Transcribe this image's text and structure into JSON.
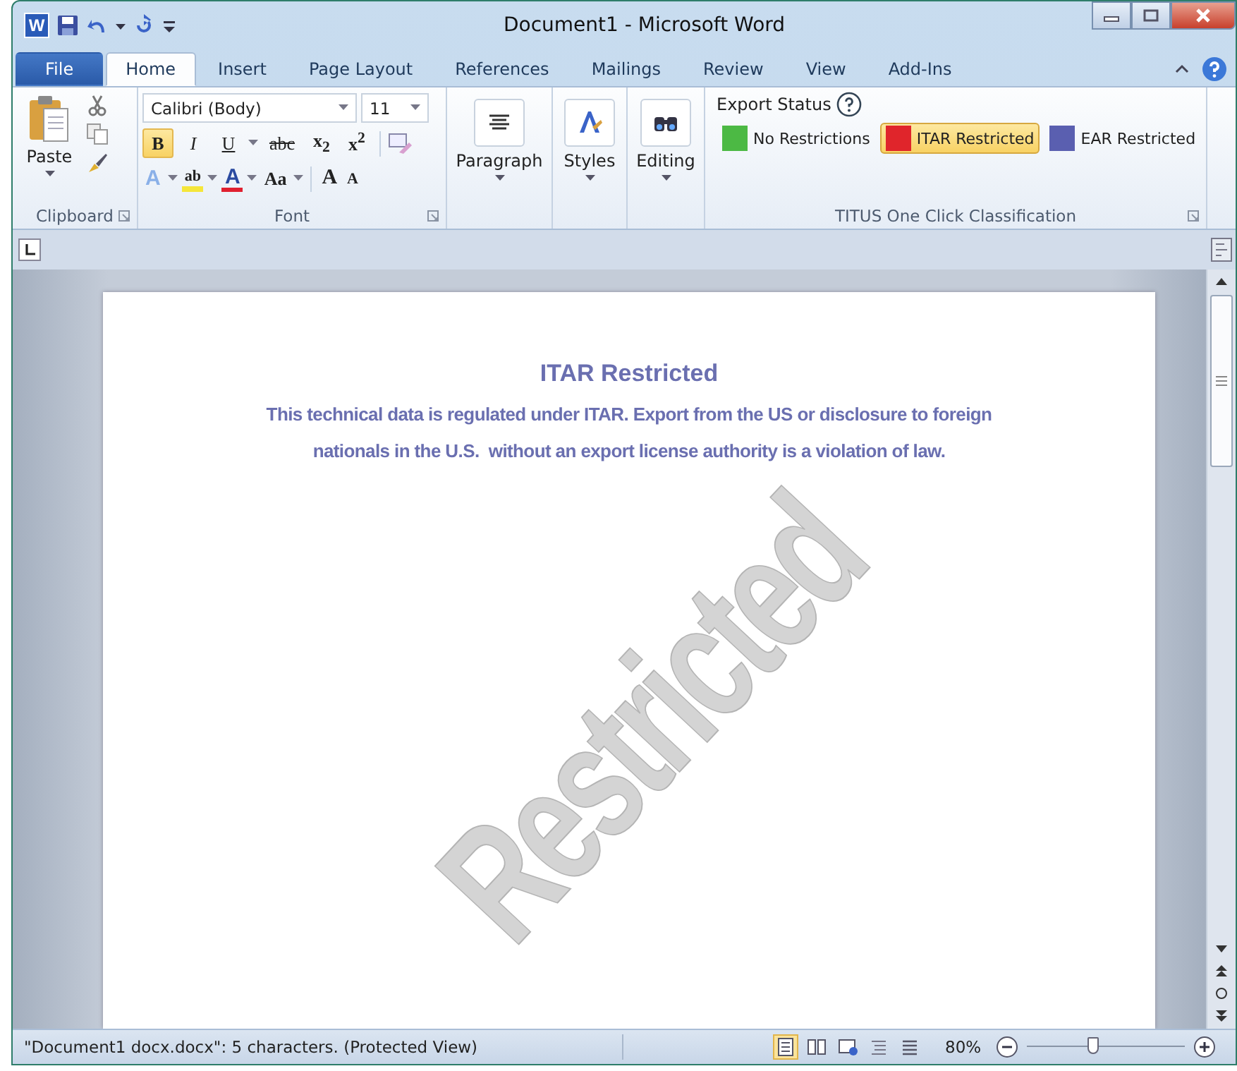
{
  "window": {
    "app_letter": "W",
    "title": "Document1 - Microsoft Word"
  },
  "tabs": [
    {
      "label": "File",
      "kind": "file",
      "selected": false
    },
    {
      "label": "Home",
      "kind": "tab",
      "selected": true
    },
    {
      "label": "Insert",
      "kind": "tab",
      "selected": false
    },
    {
      "label": "Page Layout",
      "kind": "tab",
      "selected": false
    },
    {
      "label": "References",
      "kind": "tab",
      "selected": false
    },
    {
      "label": "Mailings",
      "kind": "tab",
      "selected": false
    },
    {
      "label": "Review",
      "kind": "tab",
      "selected": false
    },
    {
      "label": "View",
      "kind": "tab",
      "selected": false
    },
    {
      "label": "Add-Ins",
      "kind": "tab",
      "selected": false
    }
  ],
  "ribbon": {
    "clipboard": {
      "paste_label": "Paste",
      "group_label": "Clipboard"
    },
    "font": {
      "font_name": "Calibri (Body)",
      "font_size": "11",
      "group_label": "Font",
      "format_buttons": [
        {
          "label": "B",
          "kind": "bold",
          "selected": true
        },
        {
          "label": "I",
          "kind": "italic",
          "selected": false
        },
        {
          "label": "U",
          "kind": "underline",
          "selected": false
        },
        {
          "label": "abc",
          "kind": "strike",
          "selected": false
        },
        {
          "label": "x$_{2}$",
          "kind": "script",
          "selected": false
        },
        {
          "label": "x$^{2}$",
          "kind": "script",
          "selected": false
        }
      ],
      "second_row": [
        {
          "label": "A",
          "kind": "effects"
        },
        {
          "label": "ab",
          "kind": "highlight"
        },
        {
          "label": "A",
          "kind": "color"
        },
        {
          "label": "Aa",
          "kind": "case"
        },
        {
          "label": "A",
          "kind": "grow"
        },
        {
          "label": "A",
          "kind": "shrink"
        }
      ]
    },
    "paragraph": {
      "label": "Paragraph"
    },
    "styles": {
      "label": "Styles"
    },
    "editing": {
      "label": "Editing"
    },
    "titus": {
      "title": "Export Status",
      "group_label": "TITUS One Click Classification",
      "options": [
        {
          "label": "No Restrictions",
          "color": "#4cb944",
          "selected": false
        },
        {
          "label": "ITAR Restricted",
          "color": "#e0252b",
          "selected": true
        },
        {
          "label": "EAR Restricted",
          "color": "#5a5fb0",
          "selected": false
        }
      ]
    }
  },
  "document": {
    "heading": "ITAR Restricted",
    "notice_lines": [
      "This technical data is regulated under ITAR. Export from the US or disclosure to foreign",
      "nationals in the U.S.  without an export license authority is a violation of law."
    ],
    "watermark": "Restricted"
  },
  "status_bar": {
    "text": "\"Document1 docx.docx\": 5 characters.  (Protected View)",
    "views": [
      {
        "selected": true
      },
      {
        "selected": false
      },
      {
        "selected": false
      },
      {
        "selected": false
      },
      {
        "selected": false
      }
    ],
    "zoom": "80%",
    "zoom_slider": {
      "level": 0.42
    }
  }
}
